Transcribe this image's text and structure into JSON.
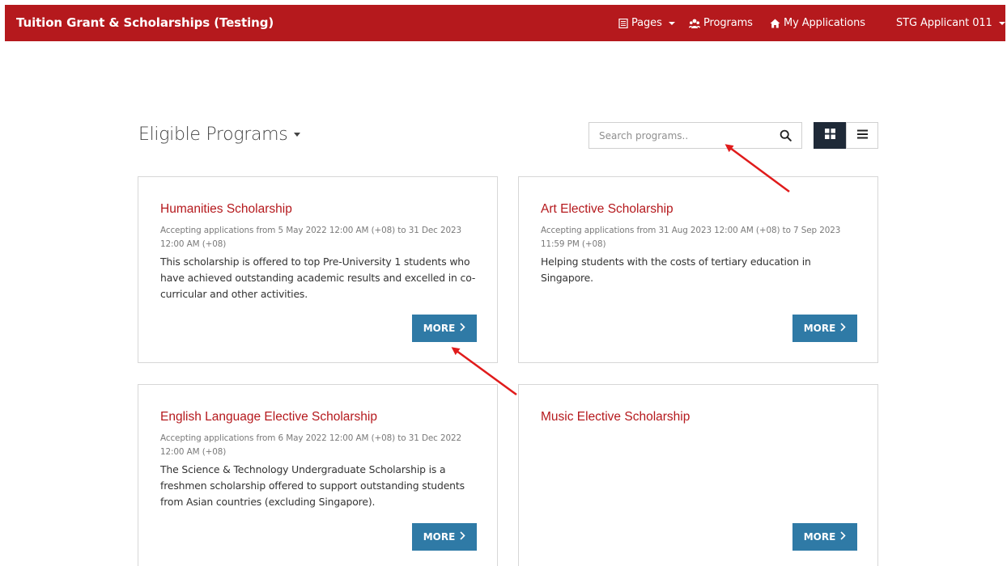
{
  "navbar": {
    "brand": "Tuition Grant & Scholarships (Testing)",
    "pages_label": "Pages",
    "programs_label": "Programs",
    "applications_label": "My Applications",
    "user_label": "STG Applicant 011",
    "color": "#b5191d"
  },
  "main": {
    "heading": "Eligible Programs",
    "search_placeholder": "Search programs..",
    "view_modes": [
      "grid",
      "list"
    ],
    "active_view": "grid"
  },
  "programs": [
    {
      "title": "Humanities Scholarship",
      "dates": "Accepting applications from 5 May 2022 12:00 AM (+08) to 31 Dec 2023 12:00 AM (+08)",
      "description": "This scholarship is offered to top Pre-University 1 students who have achieved outstanding academic results and excelled in co-curricular and other activities.",
      "button": "MORE"
    },
    {
      "title": "Art Elective Scholarship",
      "dates": "Accepting applications from 31 Aug 2023 12:00 AM (+08) to 7 Sep 2023 11:59 PM (+08)",
      "description": "Helping students with the costs of tertiary education in Singapore.",
      "button": "MORE"
    },
    {
      "title": "English Language Elective Scholarship",
      "dates": "Accepting applications from 6 May 2022 12:00 AM (+08) to 31 Dec 2022 12:00 AM (+08)",
      "description": "The Science & Technology Undergraduate Scholarship is a freshmen scholarship offered to support outstanding students from Asian countries (excluding Singapore).",
      "button": "MORE"
    },
    {
      "title": "Music Elective Scholarship",
      "dates": "",
      "description": "",
      "button": "MORE"
    }
  ],
  "colors": {
    "accent": "#b5191d",
    "button": "#2f7aa6",
    "toggle_active": "#1f2a38",
    "annotation_arrow": "#e01b1b"
  },
  "icons": {
    "pages": "document-icon",
    "programs": "people-icon",
    "applications": "home-icon",
    "search": "search-icon",
    "grid": "grid-icon",
    "list": "list-icon",
    "more": "chevron-right-icon"
  }
}
